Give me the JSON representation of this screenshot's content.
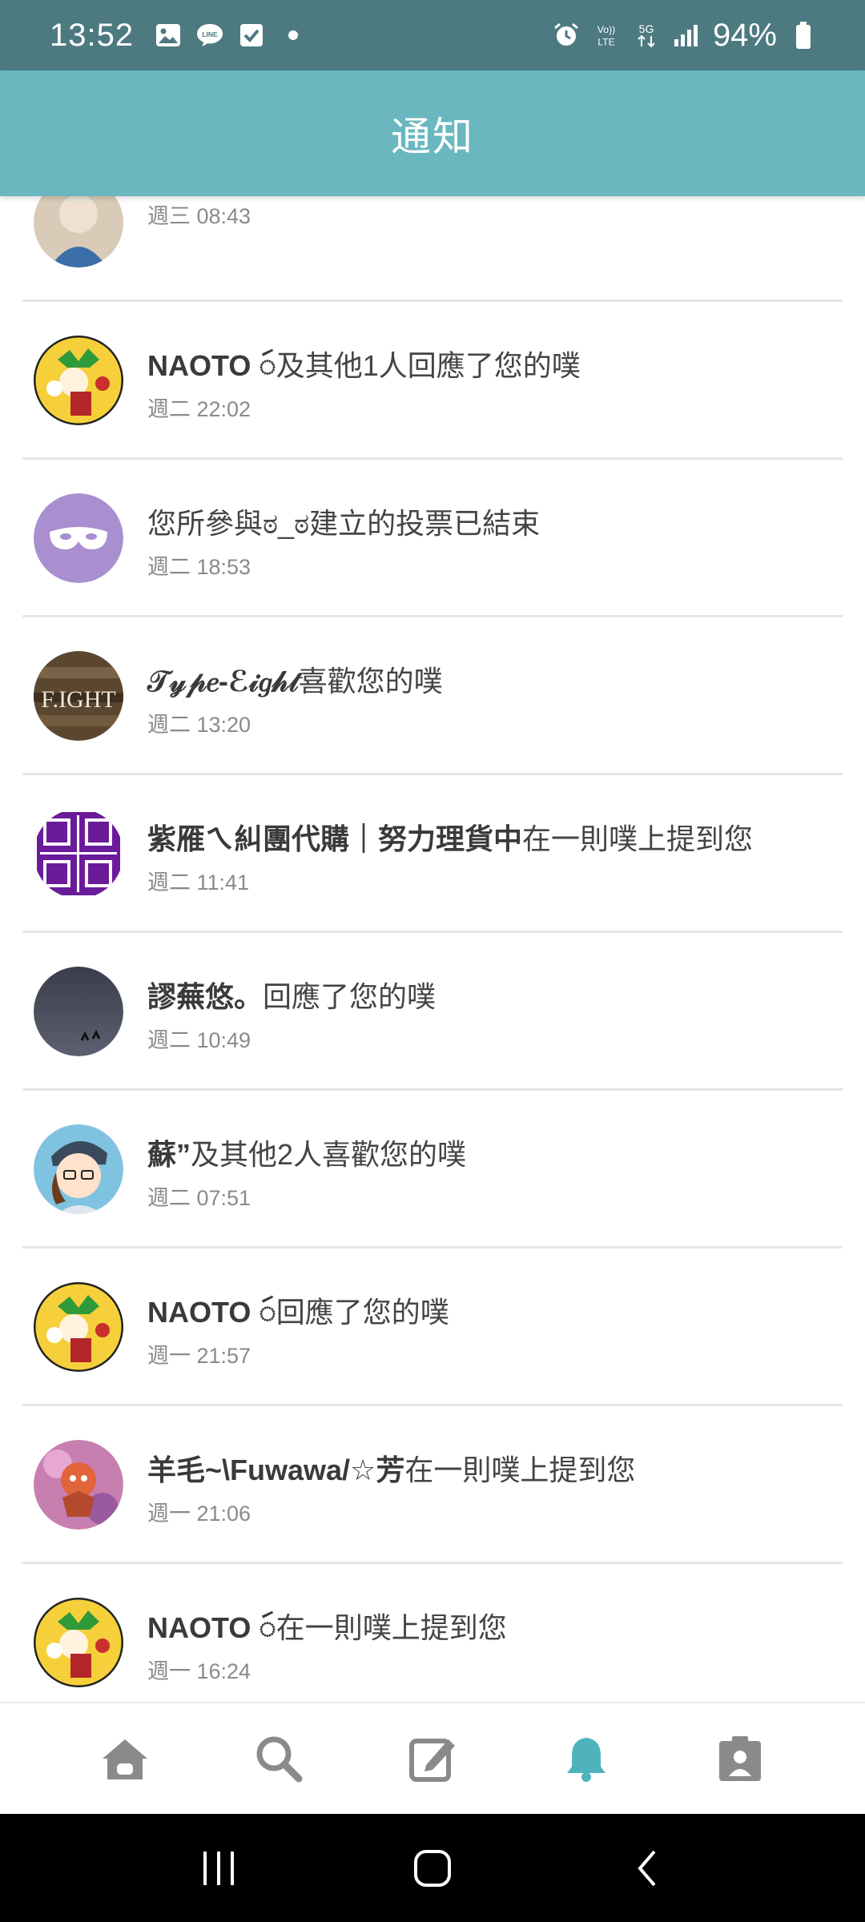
{
  "status_bar": {
    "time": "13:52",
    "left_icons": [
      "image-icon",
      "line-icon",
      "check-icon",
      "dot-icon"
    ],
    "right_icons": [
      "alarm-icon",
      "volte-icon",
      "5g-icon",
      "signal-icon",
      "battery-icon"
    ],
    "battery": "94%"
  },
  "app_bar": {
    "title": "通知"
  },
  "notifications": [
    {
      "actor": "",
      "rest": "",
      "time": "週三 08:43",
      "avatar": "photo-portrait"
    },
    {
      "actor": "NAOTO ꩃ",
      "rest": "及其他1人回應了您的噗",
      "time": "週二 22:02",
      "avatar": "cartoon-yellow"
    },
    {
      "actor": "",
      "rest": "您所參與ಠ_ಠ建立的投票已結束",
      "time": "週二 18:53",
      "avatar": "purple-mask"
    },
    {
      "actor": "𝒯𝓎𝓅𝑒-ℰ𝒾𝑔𝒽𝓉",
      "rest": "喜歡您的噗",
      "time": "週二 13:20",
      "avatar": "wood-sign"
    },
    {
      "actor": "紫雁ㄟ糾團代購｜努力理貨中",
      "rest": "在一則噗上提到您",
      "time": "週二 11:41",
      "avatar": "purple-stamp"
    },
    {
      "actor": "謬蕪悠。",
      "rest": "回應了您的噗",
      "time": "週二 10:49",
      "avatar": "dark-sky"
    },
    {
      "actor": "蘇”",
      "rest": "及其他2人喜歡您的噗",
      "time": "週二 07:51",
      "avatar": "anime-girl"
    },
    {
      "actor": "NAOTO ꩃ",
      "rest": "回應了您的噗",
      "time": "週一 21:57",
      "avatar": "cartoon-yellow"
    },
    {
      "actor": "羊毛~\\Fuwawa/☆芳",
      "rest": "在一則噗上提到您",
      "time": "週一 21:06",
      "avatar": "pink-character"
    },
    {
      "actor": "NAOTO ꩃ",
      "rest": "在一則噗上提到您",
      "time": "週一 16:24",
      "avatar": "cartoon-yellow"
    }
  ],
  "tab_bar": {
    "tabs": [
      "home-icon",
      "search-icon",
      "compose-icon",
      "bell-icon",
      "profile-icon"
    ],
    "active": "bell-icon",
    "active_color": "#4fb3bd",
    "inactive_color": "#8a8a8a"
  },
  "colors": {
    "status_bar": "#4c7a80",
    "app_bar": "#6ab7bf"
  }
}
